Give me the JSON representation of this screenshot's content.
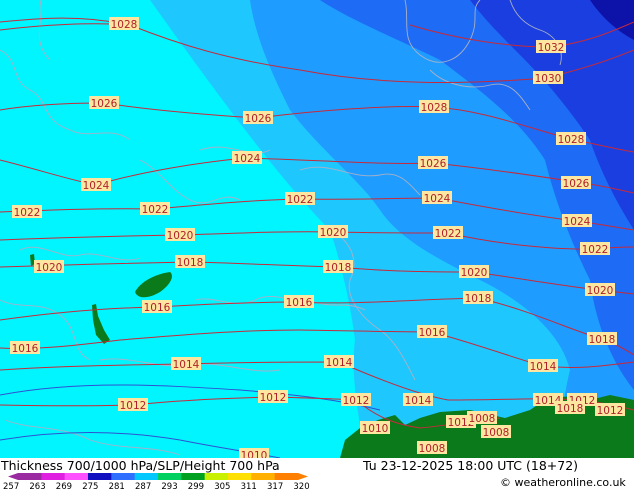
{
  "map": {
    "colors": {
      "band_aqua": "#00f5ff",
      "band_sky": "#1ec8ff",
      "band_mid": "#1f9cff",
      "band_blue": "#1e6bf5",
      "band_deep": "#1b3ee0",
      "band_navy": "#0d12a8",
      "land_green": "#0a7a1a",
      "isobar": "#c62a3a",
      "coast": "#a8b0c8",
      "height_line": "#3050d0",
      "label_bg": "#fde7a0",
      "label_text": "#b0202a"
    },
    "isobar_labels": [
      "1028",
      "1032",
      "1030",
      "1026",
      "1028",
      "1028",
      "1026",
      "1024",
      "1026",
      "1026",
      "1024",
      "1022",
      "1022",
      "1024",
      "1024",
      "1022",
      "1020",
      "1020",
      "1022",
      "1022",
      "1020",
      "1018",
      "1018",
      "1020",
      "1020",
      "1016",
      "1016",
      "1018",
      "1018",
      "1016",
      "1014",
      "1016",
      "1014",
      "1014",
      "1012",
      "1012",
      "1012",
      "1014",
      "1014",
      "1012",
      "1010",
      "1012",
      "1012",
      "1008",
      "1010",
      "1008",
      "1008",
      "1018"
    ]
  },
  "footer": {
    "title": "Thickness 700/1000 hPa/SLP/Height 700 hPa",
    "datetime": "Tu 23-12-2025 18:00 UTC (18+72)",
    "copyright": "© weatheronline.co.uk",
    "scale_values": [
      "257",
      "263",
      "269",
      "275",
      "281",
      "287",
      "293",
      "299",
      "305",
      "311",
      "317",
      "320"
    ],
    "scale_colors": [
      "#9a2aa0",
      "#e020e0",
      "#ff50ff",
      "#1010c0",
      "#2f6fff",
      "#00c8ff",
      "#00d060",
      "#00a020",
      "#c8f000",
      "#ffe000",
      "#ffb000",
      "#ff8000"
    ]
  }
}
